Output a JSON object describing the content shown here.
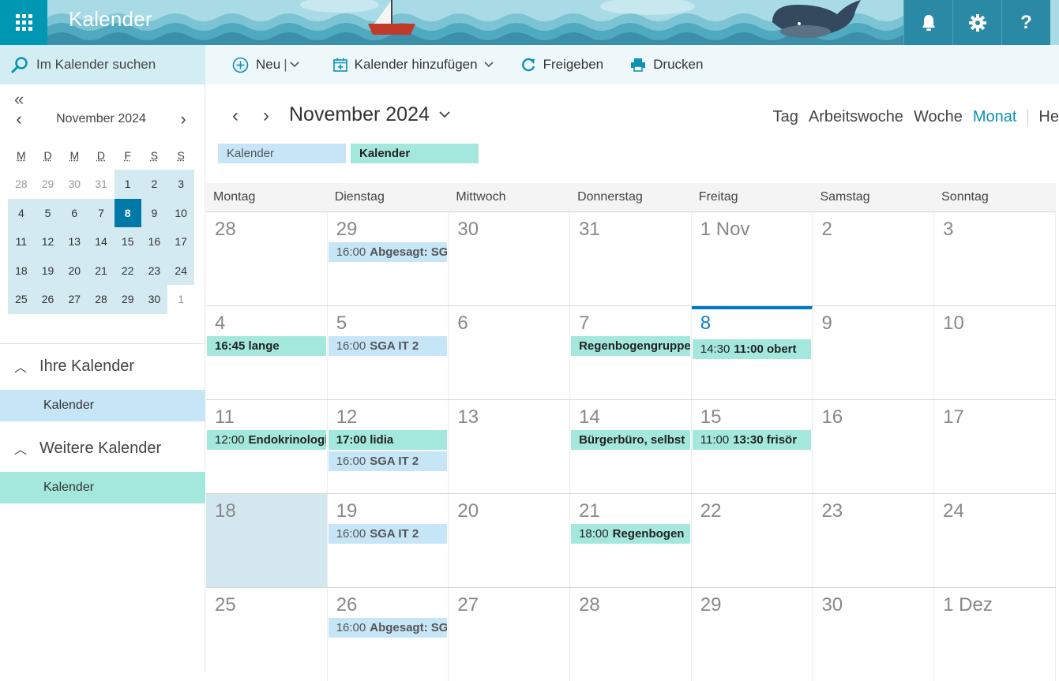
{
  "header": {
    "app_title": "Kalender",
    "icons": [
      "app-launcher-icon",
      "bell-icon",
      "gear-icon",
      "help-icon"
    ]
  },
  "search": {
    "placeholder": "Im Kalender suchen"
  },
  "toolbar": {
    "new_label": "Neu",
    "add_calendar_label": "Kalender hinzufügen",
    "share_label": "Freigeben",
    "print_label": "Drucken"
  },
  "mini_calendar": {
    "title": "November 2024",
    "weekdays": [
      "M",
      "D",
      "M",
      "D",
      "F",
      "S",
      "S"
    ],
    "days": [
      {
        "d": "28",
        "other": true,
        "inrange": false
      },
      {
        "d": "29",
        "other": true,
        "inrange": false
      },
      {
        "d": "30",
        "other": true,
        "inrange": false
      },
      {
        "d": "31",
        "other": true,
        "inrange": false
      },
      {
        "d": "1",
        "other": false,
        "inrange": true
      },
      {
        "d": "2",
        "other": false,
        "inrange": true
      },
      {
        "d": "3",
        "other": false,
        "inrange": true
      },
      {
        "d": "4",
        "other": false,
        "inrange": true
      },
      {
        "d": "5",
        "other": false,
        "inrange": true
      },
      {
        "d": "6",
        "other": false,
        "inrange": true
      },
      {
        "d": "7",
        "other": false,
        "inrange": true
      },
      {
        "d": "8",
        "other": false,
        "inrange": true,
        "today": true
      },
      {
        "d": "9",
        "other": false,
        "inrange": true
      },
      {
        "d": "10",
        "other": false,
        "inrange": true
      },
      {
        "d": "11",
        "other": false,
        "inrange": true
      },
      {
        "d": "12",
        "other": false,
        "inrange": true
      },
      {
        "d": "13",
        "other": false,
        "inrange": true
      },
      {
        "d": "14",
        "other": false,
        "inrange": true
      },
      {
        "d": "15",
        "other": false,
        "inrange": true
      },
      {
        "d": "16",
        "other": false,
        "inrange": true
      },
      {
        "d": "17",
        "other": false,
        "inrange": true
      },
      {
        "d": "18",
        "other": false,
        "inrange": true
      },
      {
        "d": "19",
        "other": false,
        "inrange": true
      },
      {
        "d": "20",
        "other": false,
        "inrange": true
      },
      {
        "d": "21",
        "other": false,
        "inrange": true
      },
      {
        "d": "22",
        "other": false,
        "inrange": true
      },
      {
        "d": "23",
        "other": false,
        "inrange": true
      },
      {
        "d": "24",
        "other": false,
        "inrange": true
      },
      {
        "d": "25",
        "other": false,
        "inrange": true
      },
      {
        "d": "26",
        "other": false,
        "inrange": true
      },
      {
        "d": "27",
        "other": false,
        "inrange": true
      },
      {
        "d": "28",
        "other": false,
        "inrange": true
      },
      {
        "d": "29",
        "other": false,
        "inrange": true
      },
      {
        "d": "30",
        "other": false,
        "inrange": true
      },
      {
        "d": "1",
        "other": true,
        "inrange": false
      }
    ]
  },
  "sidebar": {
    "your_calendars": {
      "label": "Ihre Kalender",
      "items": [
        "Kalender"
      ]
    },
    "other_calendars": {
      "label": "Weitere Kalender",
      "items": [
        "Kalender"
      ]
    }
  },
  "main": {
    "month_title": "November 2024",
    "views": [
      "Tag",
      "Arbeitswoche",
      "Woche",
      "Monat",
      "He"
    ],
    "active_view": "Monat",
    "calendar_chips": [
      "Kalender",
      "Kalender"
    ],
    "weekdays": [
      "Montag",
      "Dienstag",
      "Mittwoch",
      "Donnerstag",
      "Freitag",
      "Samstag",
      "Sonntag"
    ],
    "weeks": [
      [
        {
          "n": "28"
        },
        {
          "n": "29",
          "events": [
            {
              "time": "16:00",
              "title": "Abgesagt: SG",
              "color": "blue"
            }
          ]
        },
        {
          "n": "30"
        },
        {
          "n": "31"
        },
        {
          "n": "1 Nov"
        },
        {
          "n": "2"
        },
        {
          "n": "3"
        }
      ],
      [
        {
          "n": "4",
          "events": [
            {
              "time": "",
              "title": "16:45 lange",
              "color": "teal"
            }
          ]
        },
        {
          "n": "5",
          "events": [
            {
              "time": "16:00",
              "title": "SGA IT 2",
              "color": "blue"
            }
          ]
        },
        {
          "n": "6"
        },
        {
          "n": "7",
          "events": [
            {
              "time": "",
              "title": "Regenbogengruppe",
              "color": "teal"
            }
          ]
        },
        {
          "n": "8",
          "today": true,
          "events": [
            {
              "time": "14:30",
              "title": "11:00 obert",
              "color": "teal"
            }
          ]
        },
        {
          "n": "9"
        },
        {
          "n": "10"
        }
      ],
      [
        {
          "n": "11",
          "events": [
            {
              "time": "12:00",
              "title": "Endokrinologie",
              "color": "teal"
            }
          ]
        },
        {
          "n": "12",
          "events": [
            {
              "time": "",
              "title": "17:00 lidia",
              "color": "teal"
            },
            {
              "time": "16:00",
              "title": "SGA IT 2",
              "color": "blue"
            }
          ]
        },
        {
          "n": "13"
        },
        {
          "n": "14",
          "events": [
            {
              "time": "",
              "title": "Bürgerbüro, selbst",
              "color": "teal"
            }
          ]
        },
        {
          "n": "15",
          "events": [
            {
              "time": "11:00",
              "title": "13:30 frisör",
              "color": "teal"
            }
          ]
        },
        {
          "n": "16"
        },
        {
          "n": "17"
        }
      ],
      [
        {
          "n": "18",
          "selected": true
        },
        {
          "n": "19",
          "events": [
            {
              "time": "16:00",
              "title": "SGA IT 2",
              "color": "blue"
            }
          ]
        },
        {
          "n": "20"
        },
        {
          "n": "21",
          "events": [
            {
              "time": "18:00",
              "title": "Regenbogen",
              "color": "teal"
            }
          ]
        },
        {
          "n": "22"
        },
        {
          "n": "23"
        },
        {
          "n": "24"
        }
      ],
      [
        {
          "n": "25"
        },
        {
          "n": "26",
          "events": [
            {
              "time": "16:00",
              "title": "Abgesagt: SG",
              "color": "blue"
            }
          ]
        },
        {
          "n": "27"
        },
        {
          "n": "28"
        },
        {
          "n": "29"
        },
        {
          "n": "30"
        },
        {
          "n": "1 Dez"
        }
      ]
    ]
  },
  "colors": {
    "header_dark": "#2a8aa5",
    "accent": "#0097b2",
    "today": "#0078a8",
    "event_blue": "#c6e6f7",
    "event_teal": "#a4e8dd"
  }
}
